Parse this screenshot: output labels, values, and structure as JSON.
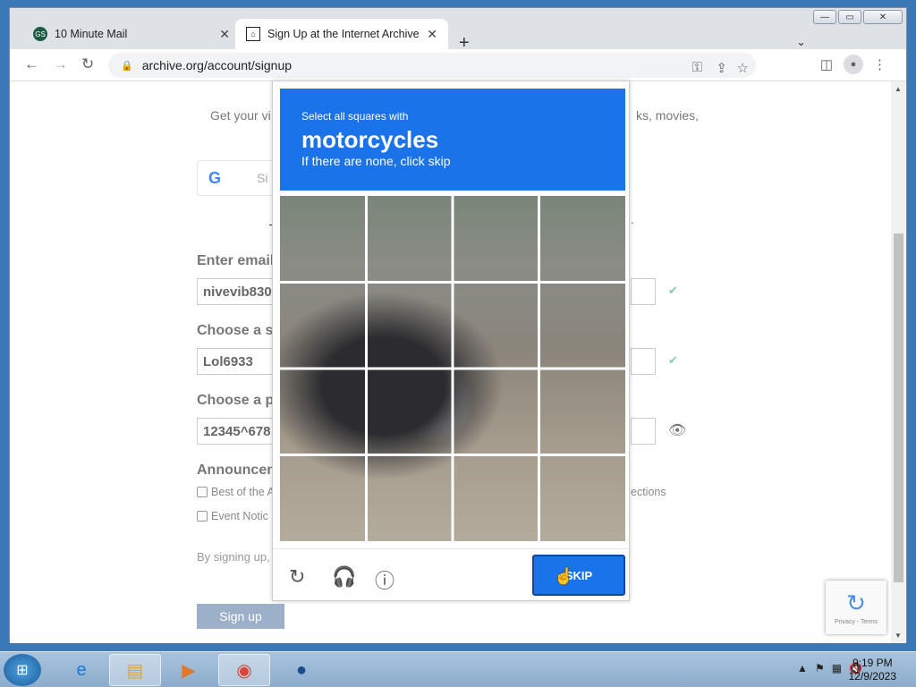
{
  "browser": {
    "tabs": [
      {
        "title": "10 Minute Mail",
        "favicon": "tenminutemail-icon",
        "active": false
      },
      {
        "title": "Sign Up at the Internet Archive",
        "favicon": "archive-icon",
        "active": true
      }
    ],
    "new_tab": "+",
    "url": "archive.org/account/signup"
  },
  "page": {
    "intro_left": "Get your vi",
    "intro_right": "ks, movies,",
    "google_label": "Si",
    "divider_dot": ".",
    "email": {
      "label": "Enter email",
      "value": "nivevib830"
    },
    "screenname": {
      "label": "Choose a s",
      "value": "Lol6933"
    },
    "password": {
      "label": "Choose a p",
      "value": "12345^678"
    },
    "announcements": {
      "label": "Announcen",
      "options": [
        {
          "label": "Best of the A",
          "suffix": "ections"
        },
        {
          "label": "Event Notic"
        }
      ]
    },
    "terms_text": "By signing up,",
    "signup_button": "Sign up",
    "recaptcha_terms": "Privacy - Terms"
  },
  "captcha": {
    "instruction_small": "Select all squares with",
    "target": "motorcycles",
    "hint": "If there are none, click skip",
    "skip_button": "SKIP",
    "footer_icons": [
      "refresh-icon",
      "headphones-icon",
      "info-icon"
    ]
  },
  "taskbar": {
    "apps": [
      "internet-explorer-icon",
      "file-explorer-icon",
      "media-player-icon",
      "chrome-icon",
      "globe-icon"
    ],
    "time": "9:19 PM",
    "date": "12/9/2023"
  }
}
